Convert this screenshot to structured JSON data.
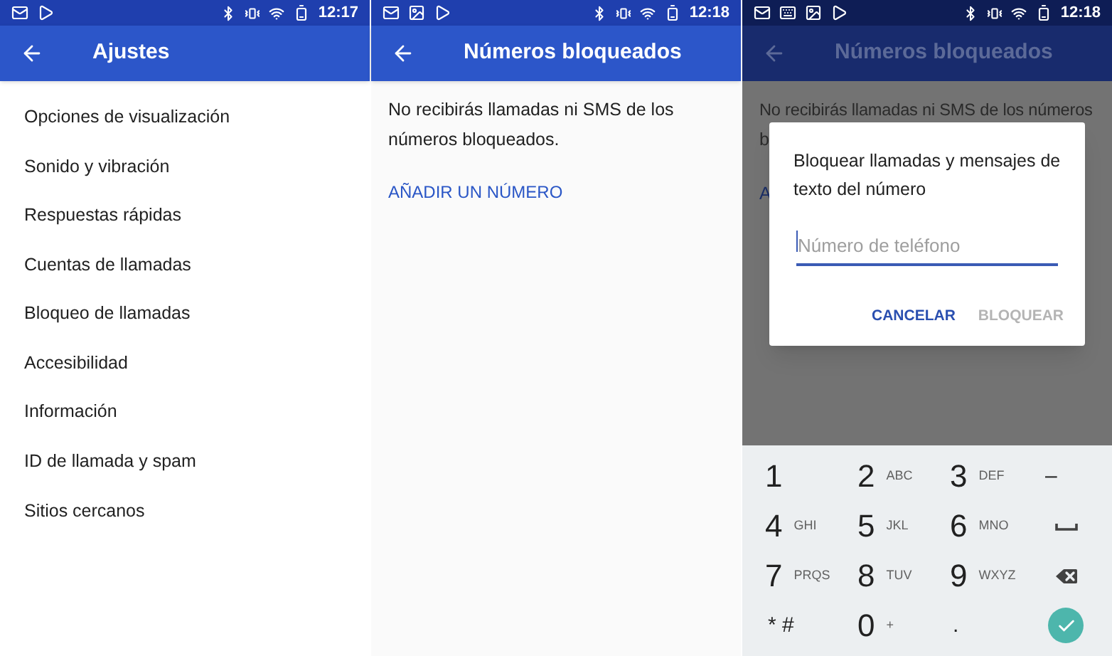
{
  "screens": [
    {
      "status_bar": {
        "notification_icons": [
          {
            "kind": "mail"
          },
          {
            "kind": "play"
          }
        ],
        "time": "12:17"
      },
      "app_bar": {
        "title": "Ajustes"
      },
      "settings_items": [
        "Opciones de visualización",
        "Sonido y vibración",
        "Respuestas rápidas",
        "Cuentas de llamadas",
        "Bloqueo de llamadas",
        "Accesibilidad",
        "Información",
        "ID de llamada y spam",
        "Sitios cercanos"
      ]
    },
    {
      "status_bar": {
        "notification_icons": [
          {
            "kind": "mail"
          },
          {
            "kind": "image"
          },
          {
            "kind": "play"
          }
        ],
        "time": "12:18"
      },
      "app_bar": {
        "title": "Números bloqueados"
      },
      "description": "No recibirás llamadas ni SMS de los números bloqueados.",
      "add_link": "AÑADIR UN NÚMERO"
    },
    {
      "status_bar": {
        "notification_icons": [
          {
            "kind": "mail"
          },
          {
            "kind": "keyboard"
          },
          {
            "kind": "image"
          },
          {
            "kind": "play"
          }
        ],
        "time": "12:18"
      },
      "app_bar": {
        "title": "Números bloqueados"
      },
      "background_texts": [
        "No recibirás llamadas ni SMS de los números",
        "b",
        "A"
      ],
      "dialog": {
        "title": "Bloquear llamadas y mensajes de texto del número",
        "placeholder": "Número de teléfono",
        "buttons": [
          {
            "label": "CANCELAR",
            "disabled": false
          },
          {
            "label": "BLOQUEAR",
            "disabled": true
          }
        ]
      },
      "keypad": [
        {
          "kind": "digit",
          "digit": "1"
        },
        {
          "kind": "digit",
          "digit": "2",
          "letters": "ABC"
        },
        {
          "kind": "digit",
          "digit": "3",
          "letters": "DEF"
        },
        {
          "kind": "symbol",
          "digit": "–"
        },
        {
          "kind": "digit",
          "digit": "4",
          "letters": "GHI"
        },
        {
          "kind": "digit",
          "digit": "5",
          "letters": "JKL"
        },
        {
          "kind": "digit",
          "digit": "6",
          "letters": "MNO"
        },
        {
          "kind": "space"
        },
        {
          "kind": "digit",
          "digit": "7",
          "letters": "PRQS"
        },
        {
          "kind": "digit",
          "digit": "8",
          "letters": "TUV"
        },
        {
          "kind": "digit",
          "digit": "9",
          "letters": "WXYZ"
        },
        {
          "kind": "backspace"
        },
        {
          "kind": "symbol",
          "digit": "* #"
        },
        {
          "kind": "digit",
          "digit": "0",
          "letters": "+"
        },
        {
          "kind": "symbol",
          "digit": "."
        },
        {
          "kind": "done"
        }
      ]
    }
  ]
}
